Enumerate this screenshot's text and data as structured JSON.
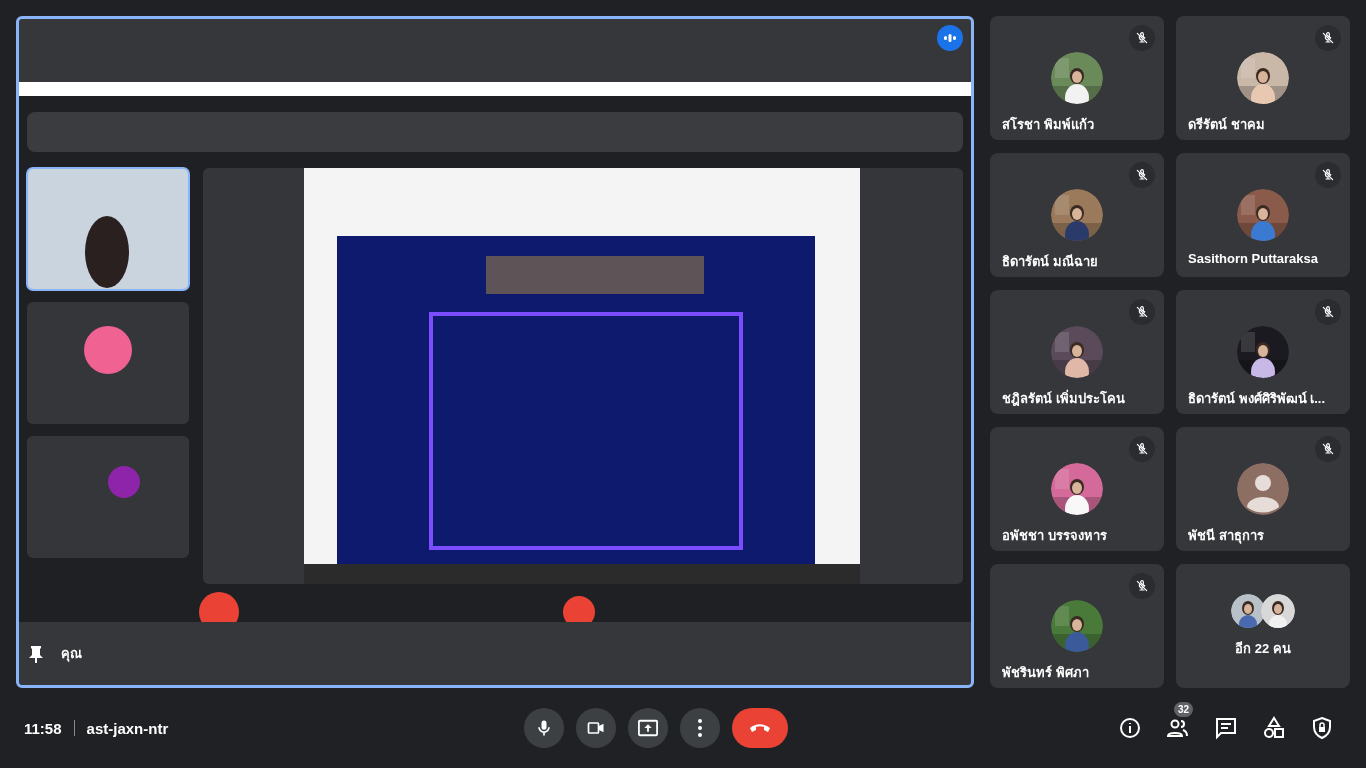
{
  "main_tile": {
    "label": "คุณ",
    "speaking": true
  },
  "participants": [
    {
      "name": "สโรชา พิมพ์แก้ว",
      "muted": true,
      "has_photo": true
    },
    {
      "name": "ดรีรัตน์ ชาคม",
      "muted": true,
      "has_photo": true
    },
    {
      "name": "ธิดารัตน์ มณีฉาย",
      "muted": true,
      "has_photo": true
    },
    {
      "name": "Sasithorn Puttaraksa",
      "muted": true,
      "has_photo": true
    },
    {
      "name": "ชฎิลรัตน์ เพิ่มประโคน",
      "muted": true,
      "has_photo": true
    },
    {
      "name": "ธิดารัตน์ พงศ์ศิริพัฒน์ เ...",
      "muted": true,
      "has_photo": true
    },
    {
      "name": "อพัชชา บรรจงหาร",
      "muted": true,
      "has_photo": true
    },
    {
      "name": "พัชนี สาธุการ",
      "muted": true,
      "has_photo": false
    },
    {
      "name": "พัชรินทร์ พิศภา",
      "muted": true,
      "has_photo": true
    }
  ],
  "more_tile": {
    "label": "อีก 22 คน"
  },
  "bottom_bar": {
    "time": "11:58",
    "meeting_code": "ast-jaxn-ntr",
    "people_count": "32"
  }
}
